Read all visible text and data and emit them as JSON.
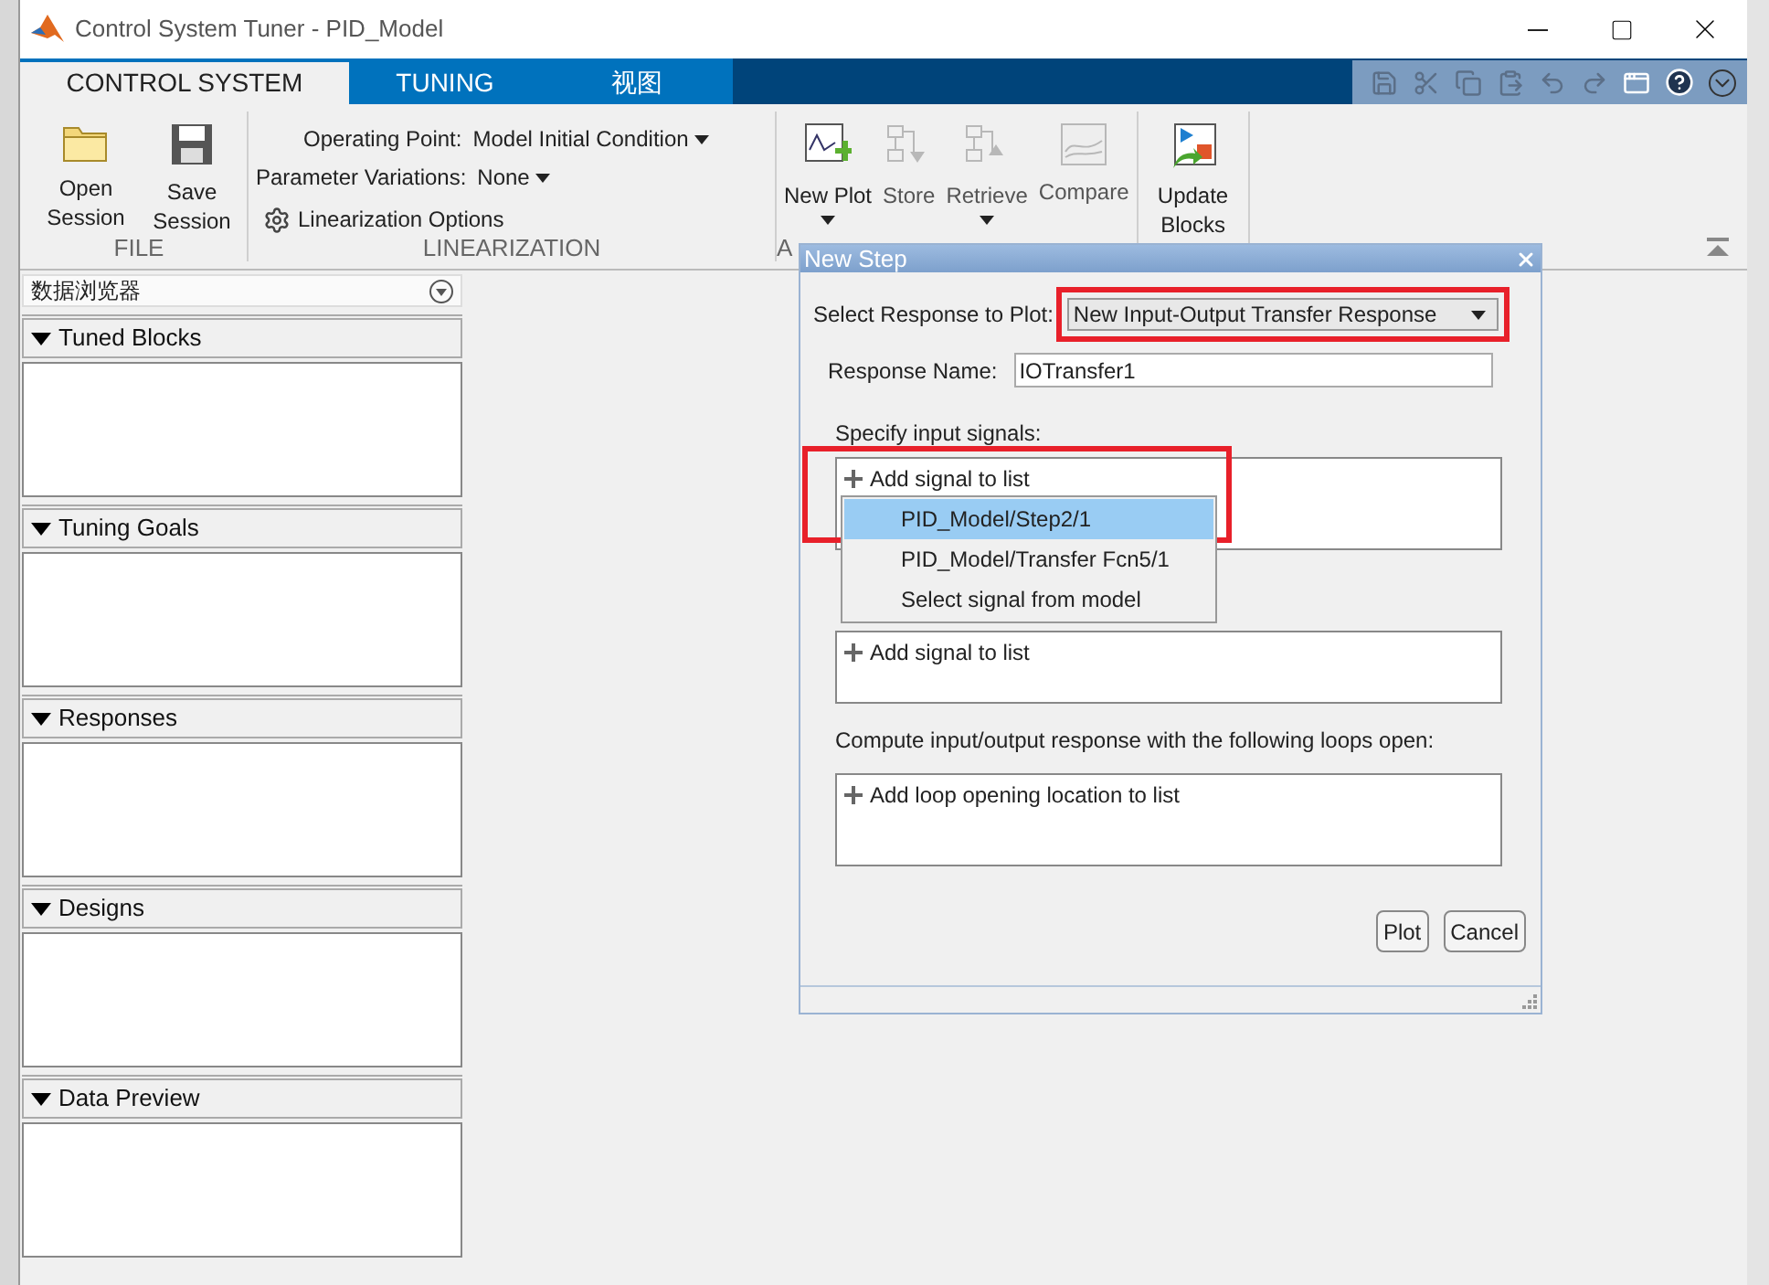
{
  "window": {
    "title": "Control System Tuner - PID_Model"
  },
  "tabs": [
    {
      "label": "CONTROL SYSTEM",
      "selected": true
    },
    {
      "label": "TUNING",
      "selected": false
    },
    {
      "label": "视图",
      "selected": false
    }
  ],
  "ribbon": {
    "groups": [
      {
        "label": "FILE",
        "kind": "buttons",
        "buttons": [
          {
            "label": "Open Session",
            "kind": "folder",
            "disabled": false,
            "dropdown": false
          },
          {
            "label": "Save Session",
            "kind": "save",
            "disabled": false,
            "dropdown": false
          }
        ]
      },
      {
        "label": "LINEARIZATION",
        "kind": "linearization",
        "operating_point": {
          "label": "Operating Point:",
          "value": "Model Initial Condition"
        },
        "parameter_variations": {
          "label": "Parameter Variations:",
          "value": "None"
        },
        "options_button": "Linearization Options"
      },
      {
        "label": "A",
        "kind": "buttons",
        "buttons": [
          {
            "label": "New Plot",
            "kind": "newplot",
            "disabled": false,
            "dropdown": true
          },
          {
            "label": "Store",
            "kind": "store",
            "disabled": true,
            "dropdown": false
          },
          {
            "label": "Retrieve",
            "kind": "retrieve",
            "disabled": true,
            "dropdown": true
          },
          {
            "label": "Compare",
            "kind": "compare",
            "disabled": true,
            "dropdown": false
          }
        ]
      },
      {
        "kind": "buttons",
        "buttons": [
          {
            "label": "Update Blocks",
            "kind": "update",
            "disabled": false,
            "dropdown": false
          }
        ]
      }
    ]
  },
  "browser": {
    "title": "数据浏览器",
    "sections": [
      {
        "label": "Tuned Blocks",
        "expanded": true
      },
      {
        "label": "Tuning Goals",
        "expanded": true
      },
      {
        "label": "Responses",
        "expanded": true
      },
      {
        "label": "Designs",
        "expanded": true
      },
      {
        "label": "Data Preview",
        "expanded": true
      }
    ]
  },
  "dialog": {
    "title": "New Step",
    "response_select": {
      "label": "Select Response to Plot:",
      "value": "New Input-Output Transfer Response",
      "highlighted": true
    },
    "response_name": {
      "label": "Response Name:",
      "value": "IOTransfer1"
    },
    "input_signals": {
      "label": "Specify input signals:",
      "add_text": "Add signal to list",
      "highlighted": true,
      "menu": [
        {
          "label": "PID_Model/Step2/1",
          "selected": true
        },
        {
          "label": "PID_Model/Transfer Fcn5/1",
          "selected": false
        },
        {
          "label": "Select signal from model",
          "selected": false
        }
      ]
    },
    "output_signals": {
      "add_text": "Add signal to list"
    },
    "loops": {
      "label": "Compute input/output response with the following loops open:",
      "add_text": "Add loop opening location to list"
    },
    "buttons": [
      "Plot",
      "Cancel"
    ]
  }
}
